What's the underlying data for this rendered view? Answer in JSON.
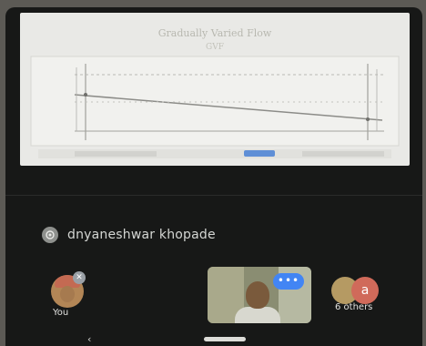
{
  "presentation": {
    "title": "Gradually Varied Flow",
    "subtitle": "GVF"
  },
  "participants": {
    "presenter_name": "dnyaneshwar khopade",
    "self_label": "You",
    "others_label": "6 others",
    "others_initial": "a",
    "audio_indicator": "•••"
  },
  "nav": {
    "back_glyph": "‹"
  }
}
